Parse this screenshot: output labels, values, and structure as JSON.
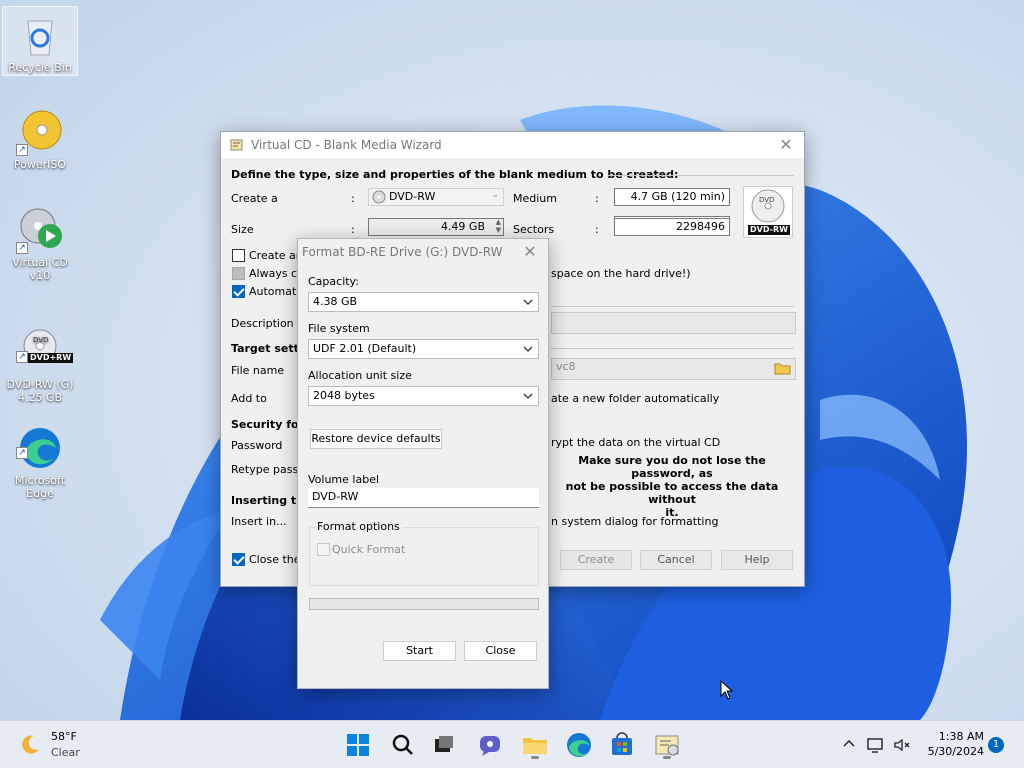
{
  "desktop": {
    "icons": [
      {
        "label": "Recycle Bin"
      },
      {
        "label": "PowerISO"
      },
      {
        "label": "Virtual CD v10"
      },
      {
        "label": "DVD-RW (G)\n4.25 GB"
      },
      {
        "label": "Microsoft\nEdge"
      }
    ],
    "dvd_badge": "DVD+RW"
  },
  "wizard": {
    "title": "Virtual CD - Blank Media Wizard",
    "heading": "Define the type, size and properties of the blank medium to be created:",
    "create_a_label": "Create a",
    "colon": ":",
    "create_a_value": "DVD-RW",
    "medium_label": "Medium",
    "medium_value": "4.7 GB (120 min)",
    "size_label": "Size",
    "size_value": "4.49 GB",
    "sectors_label": "Sectors",
    "sectors_value": "2298496",
    "media_badge": "DVD-RW",
    "create_an_partial": "Create an",
    "always_partial": "Always cre",
    "auto_partial": "Automatic",
    "hard_drive_note": "space on the hard drive!)",
    "description_label": "Description",
    "target_partial": "Target setting",
    "file_name_label": "File name",
    "file_name_partial": "vc8",
    "add_to_label": "Add to",
    "folder_auto_text": "ate a new folder automatically",
    "security_partial": "Security for t",
    "password_label": "Password",
    "encrypt_text": "rypt the data on the virtual CD",
    "retype_partial": "Retype passw",
    "warning_text": "Make sure you do not lose the password, as\nnot be possible to access the data without\nit.",
    "inserting_partial": "Inserting the",
    "insert_in_label": "Insert in...",
    "system_dialog_text": "n system dialog for formatting",
    "close_partial": "Close the p",
    "buttons": {
      "create": "Create",
      "cancel": "Cancel",
      "help": "Help"
    }
  },
  "format_dialog": {
    "title": "Format BD-RE Drive (G:) DVD-RW",
    "capacity_label": "Capacity:",
    "capacity_value": "4.38 GB",
    "file_system_label": "File system",
    "file_system_value": "UDF 2.01 (Default)",
    "alloc_label": "Allocation unit size",
    "alloc_value": "2048 bytes",
    "restore_button": "Restore device defaults",
    "volume_label_label": "Volume label",
    "volume_label_value": "DVD-RW",
    "format_options_label": "Format options",
    "quick_format_label": "Quick Format",
    "progress": 0,
    "start_button": "Start",
    "close_button": "Close"
  },
  "taskbar": {
    "weather_temp": "58°F",
    "weather_desc": "Clear",
    "time": "1:38 AM",
    "date": "5/30/2024",
    "notification_count": "1",
    "apps": [
      "windows-start-icon",
      "search-icon",
      "task-view-icon",
      "teams-chat-icon",
      "file-explorer-icon",
      "edge-icon",
      "store-icon",
      "virtual-cd-icon"
    ]
  },
  "colors": {
    "accent": "#0067c0",
    "wallpaper_bg": "#d6e4f2",
    "bloom_blue": "#1560d8"
  }
}
